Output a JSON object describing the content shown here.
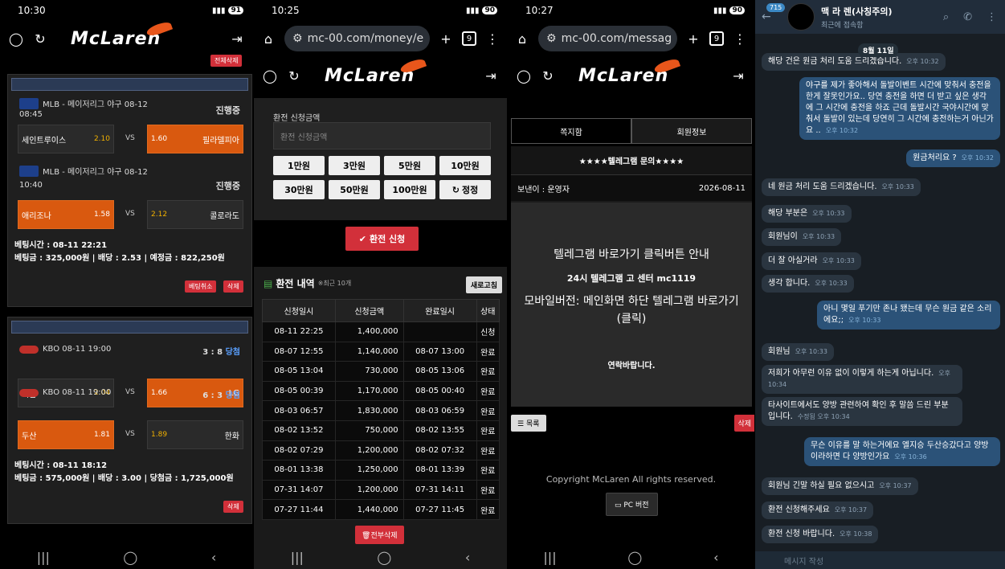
{
  "panel1": {
    "status_time": "10:30",
    "battery": "91",
    "top_button": "전체삭제",
    "card1": {
      "games": [
        {
          "league": "MLB - 메이저리그 야구 08-12",
          "time": "08:45",
          "state": "진행중",
          "home": "세인트루이스",
          "home_odd": "2.10",
          "away_odd": "1.60",
          "away": "필라델피아",
          "selected": "away"
        },
        {
          "league": "MLB - 메이저리그 야구 08-12",
          "time": "10:40",
          "state": "진행중",
          "home": "애리조나",
          "home_odd": "1.58",
          "away_odd": "2.12",
          "away": "콜로라도",
          "selected": "home"
        }
      ],
      "vs": "VS",
      "bet_time": "베팅시간 : 08-11 22:21",
      "bet_line": "베팅금 : 325,000원  |  배당 : 2.53  |  예정금 : 822,250원",
      "cancel_label": "베팅취소",
      "delete_label": "삭제"
    },
    "card2": {
      "games": [
        {
          "league": "KBO 08-11 19:00",
          "score": "3 : 8",
          "result": "당첨",
          "home": "키움",
          "home_odd": "2.04",
          "away_odd": "1.66",
          "away": "LG",
          "selected": "away"
        },
        {
          "league": "KBO 08-11 19:00",
          "score": "6 : 3",
          "result": "당첨",
          "home": "두산",
          "home_odd": "1.81",
          "away_odd": "1.89",
          "away": "한화",
          "selected": "home"
        }
      ],
      "vs": "VS",
      "bet_time": "베팅시간 : 08-11 18:12",
      "bet_line": "베팅금 : 575,000원  |  배당 : 3.00  |  당첨금 : 1,725,000원",
      "delete_label": "삭제"
    }
  },
  "panel2": {
    "status_time": "10:25",
    "battery": "90",
    "url": "mc-00.com/money/e",
    "tab_count": "9",
    "form_label": "환전 신청금액",
    "form_placeholder": "환전 신청금액",
    "amounts": [
      "1만원",
      "3만원",
      "5만원",
      "10만원",
      "30만원",
      "50만원",
      "100만원",
      "정정"
    ],
    "submit": "환전 신청",
    "history_title": "환전 내역",
    "history_note": "※최근 10개",
    "refresh": "새로고침",
    "columns": [
      "신청일시",
      "신청금액",
      "완료일시",
      "상태"
    ],
    "rows": [
      [
        "08-11 22:25",
        "1,400,000",
        "",
        "신청"
      ],
      [
        "08-07 12:55",
        "1,140,000",
        "08-07 13:00",
        "완료"
      ],
      [
        "08-05 13:04",
        "730,000",
        "08-05 13:06",
        "완료"
      ],
      [
        "08-05 00:39",
        "1,170,000",
        "08-05 00:40",
        "완료"
      ],
      [
        "08-03 06:57",
        "1,830,000",
        "08-03 06:59",
        "완료"
      ],
      [
        "08-02 13:52",
        "750,000",
        "08-02 13:55",
        "완료"
      ],
      [
        "08-02 07:29",
        "1,200,000",
        "08-02 07:32",
        "완료"
      ],
      [
        "08-01 13:38",
        "1,250,000",
        "08-01 13:39",
        "완료"
      ],
      [
        "07-31 14:07",
        "1,200,000",
        "07-31 14:11",
        "완료"
      ],
      [
        "07-27 11:44",
        "1,440,000",
        "07-27 11:45",
        "완료"
      ]
    ],
    "delete_all": "전부삭제"
  },
  "panel3": {
    "status_time": "10:27",
    "battery": "90",
    "url": "mc-00.com/messag",
    "tab_count": "9",
    "tab_active": "쪽지함",
    "tab_inactive": "회원정보",
    "msg_title": "★★★★텔레그램 문의★★★★",
    "sender": "보낸이 : 운영자",
    "date": "2026-08-11",
    "body_line1": "텔레그램 바로가기 클릭버튼 안내",
    "body_line2": "24시 텔레그램 고  센터 mc1119",
    "body_line3": "모바일버전: 메인화면 하단 텔레그램 바로가기",
    "body_line4": "(클릭)",
    "body_line5": "연락바랍니다.",
    "list_btn": "목록",
    "del_btn": "삭제",
    "copyright": "Copyright McLaren All rights reserved.",
    "pc_btn": "PC 버전"
  },
  "panel4": {
    "unread": "715",
    "name": "맥 라 렌(사칭주의)",
    "status": "최근에 접속함",
    "date_pill": "8월 11일",
    "input_placeholder": "메시지 작성",
    "messages": [
      {
        "dir": "in",
        "text": "해당 건은 원금 처리 도움 드리겠습니다.",
        "time": "오후 10:32"
      },
      {
        "dir": "out",
        "text": "야구를 제가 좋아해서 돌발이벤트 시간에 맞춰서 충전을 한게 잘못인가요.. 당연 충전을 하면 더 받고 싶은 생각에 그 시간에 충전을 하죠 근데 돌발시간 국야시간에 맞춰서 돌발이 있는데 당연히 그 시간에 충전하는거 아닌가요 ..",
        "time": "오후 10:32"
      },
      {
        "dir": "out",
        "text": "원금처리요 ?",
        "time": "오후 10:32"
      },
      {
        "dir": "in",
        "text": "네 원금 처리 도움 드리겠습니다.",
        "time": "오후 10:33"
      },
      {
        "dir": "in",
        "text": "해당 부분은",
        "time": "오후 10:33"
      },
      {
        "dir": "in",
        "text": "회원님이",
        "time": "오후 10:33"
      },
      {
        "dir": "in",
        "text": "더 잘 아실거라",
        "time": "오후 10:33"
      },
      {
        "dir": "in",
        "text": "생각 합니다.",
        "time": "오후 10:33"
      },
      {
        "dir": "out",
        "text": "아니 몇일 푸기만 존나 됐는데 무슨 원금 같은 소리에요;;",
        "time": "오후 10:33"
      },
      {
        "dir": "in",
        "text": "회원님",
        "time": "오후 10:33"
      },
      {
        "dir": "in",
        "text": "저희가 아무런 이유 없이 이렇게 하는게 아닙니다.",
        "time": "오후 10:34"
      },
      {
        "dir": "in",
        "text": "타사이트에서도 양방 관련하여 확인 후 말씀 드린 부분 입니다.",
        "time": "수정됨 오후 10:34"
      },
      {
        "dir": "out",
        "text": "무슨 이유를 말 하는거에요 엘지승 두산승갔다고 양방이라하면 다 양방인가요",
        "time": "오후 10:36"
      },
      {
        "dir": "in",
        "text": "회원님 긴말 하실 필요 없으시고",
        "time": "오후 10:37"
      },
      {
        "dir": "in",
        "text": "환전 신청해주세요",
        "time": "오후 10:37"
      },
      {
        "dir": "in",
        "text": "환전 신청 바랍니다.",
        "time": "오후 10:38"
      }
    ]
  },
  "colors": {
    "accent": "#d9590f",
    "red": "#d2303a",
    "tg_out": "#2b5278",
    "tg_in": "#2a3540"
  }
}
